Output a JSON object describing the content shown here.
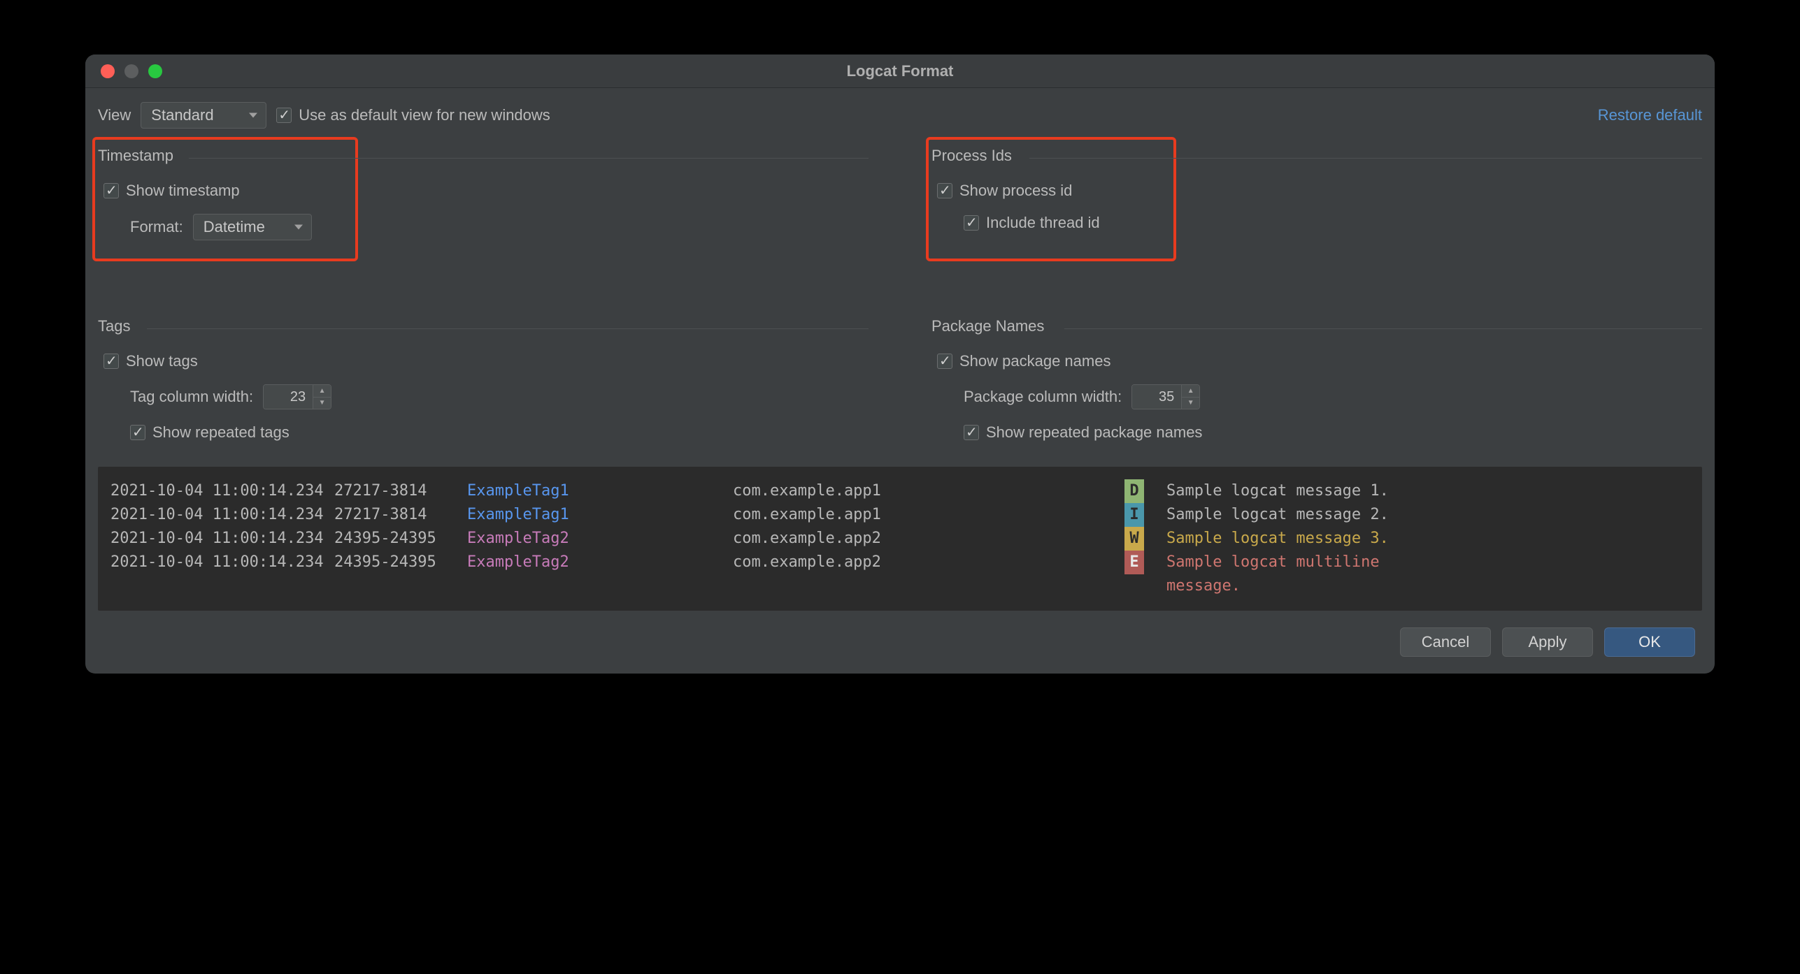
{
  "window": {
    "title": "Logcat Format"
  },
  "toolbar": {
    "view_label": "View",
    "view_value": "Standard",
    "default_checkbox": "Use as default view for new windows",
    "restore_link": "Restore default"
  },
  "groups": {
    "timestamp": {
      "title": "Timestamp",
      "show": "Show timestamp",
      "format_label": "Format:",
      "format_value": "Datetime"
    },
    "process": {
      "title": "Process Ids",
      "show": "Show process id",
      "include_tid": "Include thread id"
    },
    "tags": {
      "title": "Tags",
      "show": "Show tags",
      "width_label": "Tag column width:",
      "width_value": "23",
      "repeated": "Show repeated tags"
    },
    "packages": {
      "title": "Package Names",
      "show": "Show package names",
      "width_label": "Package column width:",
      "width_value": "35",
      "repeated": "Show repeated package names"
    }
  },
  "preview": {
    "rows": [
      {
        "ts": "2021-10-04 11:00:14.234",
        "pid": "27217-3814",
        "tag": "ExampleTag1",
        "tagcls": "tag1",
        "pkg": "com.example.app1",
        "lvl": "D",
        "msg": "Sample logcat message 1."
      },
      {
        "ts": "2021-10-04 11:00:14.234",
        "pid": "27217-3814",
        "tag": "ExampleTag1",
        "tagcls": "tag1",
        "pkg": "com.example.app1",
        "lvl": "I",
        "msg": "Sample logcat message 2."
      },
      {
        "ts": "2021-10-04 11:00:14.234",
        "pid": "24395-24395",
        "tag": "ExampleTag2",
        "tagcls": "tag2",
        "pkg": "com.example.app2",
        "lvl": "W",
        "msg": "Sample logcat message 3."
      },
      {
        "ts": "2021-10-04 11:00:14.234",
        "pid": "24395-24395",
        "tag": "ExampleTag2",
        "tagcls": "tag2",
        "pkg": "com.example.app2",
        "lvl": "E",
        "msg": "Sample logcat multiline",
        "msg2": "message."
      }
    ]
  },
  "footer": {
    "cancel": "Cancel",
    "apply": "Apply",
    "ok": "OK"
  }
}
